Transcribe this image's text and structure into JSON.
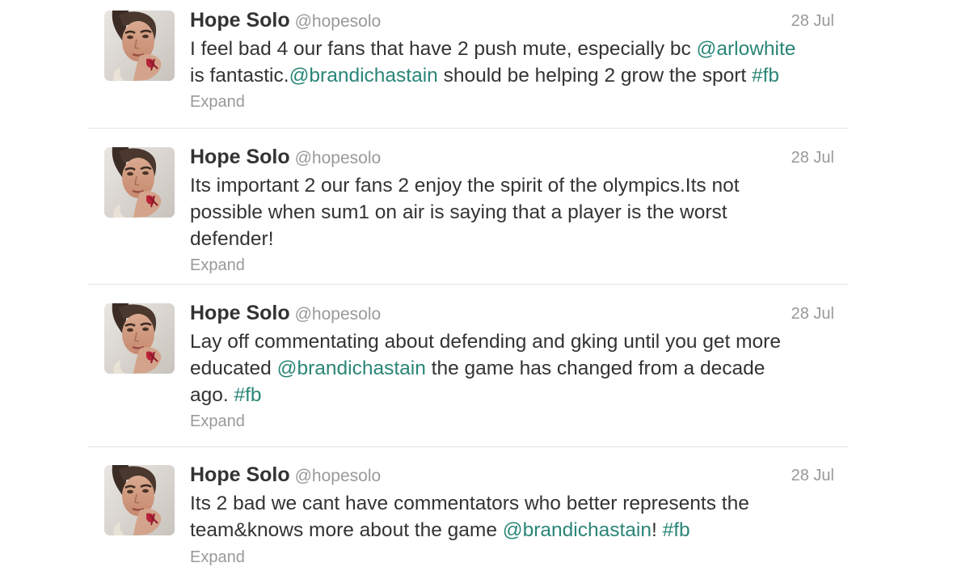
{
  "tweets": [
    {
      "name": "Hope Solo",
      "handle": "@hopesolo",
      "time": "28 Jul",
      "lines": [
        [
          {
            "t": "I feel bad 4 our fans that have 2 push mute, especially bc "
          },
          {
            "t": "@arlowhite",
            "link": true
          }
        ],
        [
          {
            "t": "is fantastic."
          },
          {
            "t": "@brandichastain",
            "link": true
          },
          {
            "t": " should be helping 2 grow the sport "
          },
          {
            "t": "#fb",
            "link": true
          }
        ]
      ],
      "expand": "Expand"
    },
    {
      "name": "Hope Solo",
      "handle": "@hopesolo",
      "time": "28 Jul",
      "lines": [
        [
          {
            "t": "Its important 2 our fans 2 enjoy the spirit of the olympics.Its not"
          }
        ],
        [
          {
            "t": "possible when sum1 on air is saying that a player is the worst"
          }
        ],
        [
          {
            "t": "defender!"
          }
        ]
      ],
      "expand": "Expand"
    },
    {
      "name": "Hope Solo",
      "handle": "@hopesolo",
      "time": "28 Jul",
      "lines": [
        [
          {
            "t": "Lay off commentating about defending and gking until you get more"
          }
        ],
        [
          {
            "t": "educated "
          },
          {
            "t": "@brandichastain",
            "link": true
          },
          {
            "t": " the game has changed from a decade"
          }
        ],
        [
          {
            "t": "ago. "
          },
          {
            "t": "#fb",
            "link": true
          }
        ]
      ],
      "expand": "Expand"
    },
    {
      "name": "Hope Solo",
      "handle": "@hopesolo",
      "time": "28 Jul",
      "lines": [
        [
          {
            "t": "Its 2 bad we cant have commentators who better represents the"
          }
        ],
        [
          {
            "t": "team&knows more about the game "
          },
          {
            "t": "@brandichastain",
            "link": true
          },
          {
            "t": "! "
          },
          {
            "t": "#fb",
            "link": true
          }
        ]
      ],
      "expand": "Expand"
    }
  ],
  "colors": {
    "link": "#2a8577",
    "text": "#333333",
    "muted": "#999999",
    "divider": "#e4e4e4"
  },
  "icons": {
    "avatar": "profile-photo"
  }
}
